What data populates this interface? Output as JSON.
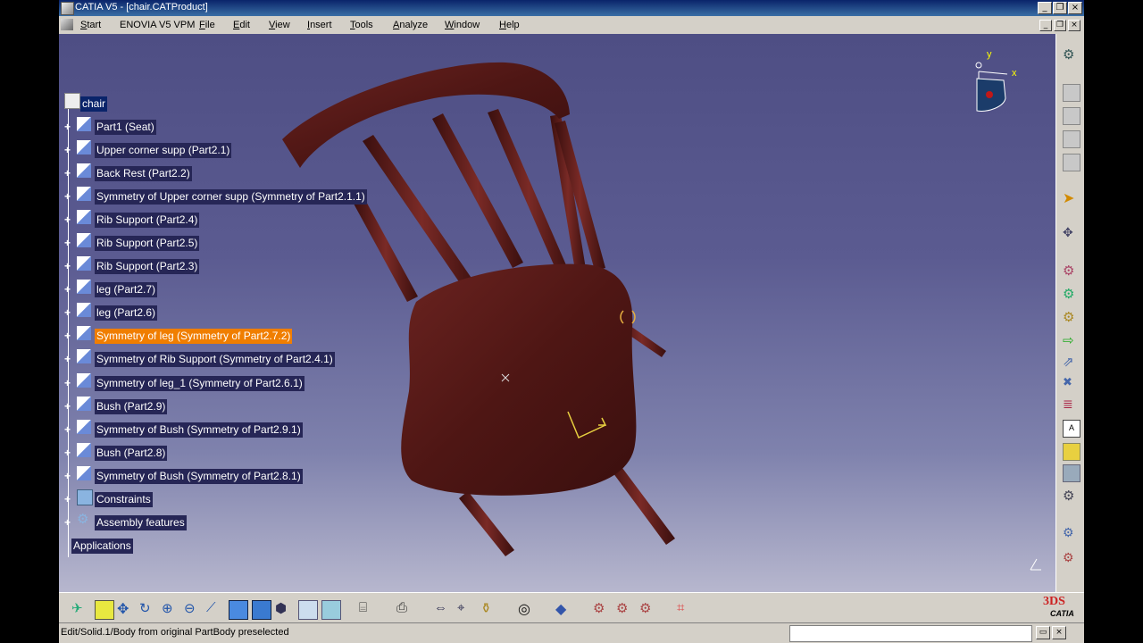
{
  "window": {
    "title": "CATIA V5 - [chair.CATProduct]"
  },
  "menu": {
    "items": [
      "Start",
      "ENOVIA V5 VPM",
      "File",
      "Edit",
      "View",
      "Insert",
      "Tools",
      "Analyze",
      "Window",
      "Help"
    ]
  },
  "tree": {
    "root": "chair",
    "nodes": [
      {
        "label": "Part1 (Seat)"
      },
      {
        "label": "Upper corner supp (Part2.1)"
      },
      {
        "label": "Back Rest (Part2.2)"
      },
      {
        "label": "Symmetry of Upper corner supp (Symmetry of Part2.1.1)"
      },
      {
        "label": "Rib Support (Part2.4)"
      },
      {
        "label": "Rib Support (Part2.5)"
      },
      {
        "label": "Rib Support (Part2.3)"
      },
      {
        "label": "leg (Part2.7)"
      },
      {
        "label": "leg (Part2.6)"
      },
      {
        "label": "Symmetry of leg (Symmetry of Part2.7.2)",
        "selected": true
      },
      {
        "label": "Symmetry of Rib Support (Symmetry of Part2.4.1)"
      },
      {
        "label": "Symmetry of leg_1 (Symmetry of Part2.6.1)"
      },
      {
        "label": "Bush (Part2.9)"
      },
      {
        "label": "Symmetry of Bush (Symmetry of Part2.9.1)"
      },
      {
        "label": "Bush (Part2.8)"
      },
      {
        "label": "Symmetry of Bush (Symmetry of Part2.8.1)"
      },
      {
        "label": "Constraints"
      },
      {
        "label": "Assembly features"
      }
    ],
    "applications": "Applications"
  },
  "compass": {
    "x_label": "x",
    "y_label": "y"
  },
  "status": {
    "text": "Edit/Solid.1/Body from original PartBody preselected"
  },
  "logo": {
    "text": "CATIA"
  },
  "colors": {
    "accent_selected": "#f07e00",
    "tree_label_bg": "#262656",
    "wood": "#5a1a18"
  }
}
